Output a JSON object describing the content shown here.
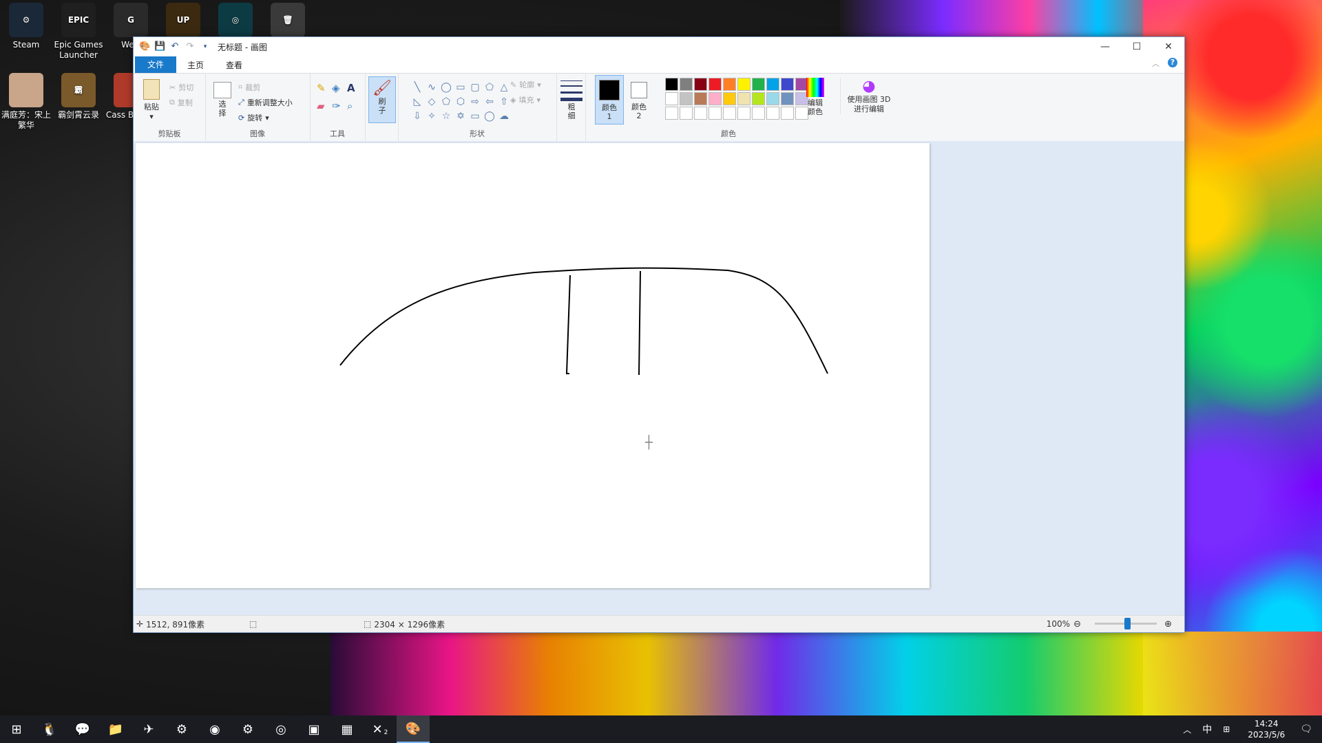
{
  "desktop": {
    "icons": [
      {
        "label": "Steam",
        "name": "steam",
        "glyph": "⚙",
        "bg": "#1b2838"
      },
      {
        "label": "Epic Games Launcher",
        "name": "epic-games",
        "glyph": "EPIC",
        "bg": "#1f1f1f"
      },
      {
        "label": "WeG",
        "name": "wegame",
        "glyph": "G",
        "bg": "#2a2a2a"
      },
      {
        "label": "",
        "name": "up-game",
        "glyph": "UP",
        "bg": "#3b2a10"
      },
      {
        "label": "",
        "name": "ring-app",
        "glyph": "◎",
        "bg": "#0d3b44"
      },
      {
        "label": "",
        "name": "recycle-bin",
        "glyph": "🗑",
        "bg": "#3a3a3a"
      },
      {
        "label": "满庭芳：宋上繁华",
        "name": "mantingfang",
        "glyph": "",
        "bg": "#c9a58a"
      },
      {
        "label": "霸剑霄云录",
        "name": "bajianxiaoyunlu",
        "glyph": "霸",
        "bg": "#7a5a2a"
      },
      {
        "label": "Cass Beasts",
        "name": "cassette-beasts",
        "glyph": "",
        "bg": "#b03a2a"
      }
    ]
  },
  "paint": {
    "title": "无标题 - 画图",
    "tabs": {
      "file": "文件",
      "home": "主页",
      "view": "查看"
    },
    "clipboard": {
      "paste": "粘贴",
      "cut": "剪切",
      "copy": "复制",
      "label": "剪贴板"
    },
    "image": {
      "select": "选择",
      "crop": "裁剪",
      "resize": "重新调整大小",
      "rotate": "旋转",
      "label": "图像"
    },
    "tools": {
      "label": "工具"
    },
    "brush": {
      "label": "刷子"
    },
    "shapes": {
      "label": "形状",
      "outline": "轮廓",
      "fill": "填充"
    },
    "size": {
      "label": "粗细"
    },
    "color1": {
      "label": "颜色 1"
    },
    "color2": {
      "label": "颜色 2"
    },
    "colors": {
      "label": "颜色",
      "edit": "编辑颜色",
      "row1": [
        "#000000",
        "#7f7f7f",
        "#880015",
        "#ed1c24",
        "#ff7f27",
        "#fff200",
        "#22b14c",
        "#00a2e8",
        "#3f48cc",
        "#a349a4"
      ],
      "row2": [
        "#ffffff",
        "#c3c3c3",
        "#b97a57",
        "#ffaec9",
        "#ffc90e",
        "#efe4b0",
        "#b5e61d",
        "#99d9ea",
        "#7092be",
        "#c8bfe7"
      ],
      "row3": [
        "#ffffff",
        "#ffffff",
        "#ffffff",
        "#ffffff",
        "#ffffff",
        "#ffffff",
        "#ffffff",
        "#ffffff",
        "#ffffff",
        "#ffffff"
      ]
    },
    "paint3d": "使用画图 3D 进行编辑",
    "status": {
      "cursor_pos": "1512, 891像素",
      "canvas_size": "2304 × 1296像素",
      "zoom": "100%"
    }
  },
  "taskbar": {
    "items": [
      {
        "name": "start",
        "glyph": "⊞"
      },
      {
        "name": "qq",
        "glyph": "🐧"
      },
      {
        "name": "wechat",
        "glyph": "💬"
      },
      {
        "name": "file-explorer",
        "glyph": "📁"
      },
      {
        "name": "feishu",
        "glyph": "✈"
      },
      {
        "name": "steam",
        "glyph": "⚙"
      },
      {
        "name": "chrome",
        "glyph": "◉"
      },
      {
        "name": "settings-app",
        "glyph": "⚙"
      },
      {
        "name": "ring-app",
        "glyph": "◎"
      },
      {
        "name": "photos",
        "glyph": "▣"
      },
      {
        "name": "store",
        "glyph": "▦"
      },
      {
        "name": "xbox",
        "glyph": "✕"
      },
      {
        "name": "paint",
        "glyph": "🎨"
      }
    ],
    "xbox_badge": "2",
    "ime": "中",
    "time": "14:24",
    "date": "2023/5/6"
  }
}
